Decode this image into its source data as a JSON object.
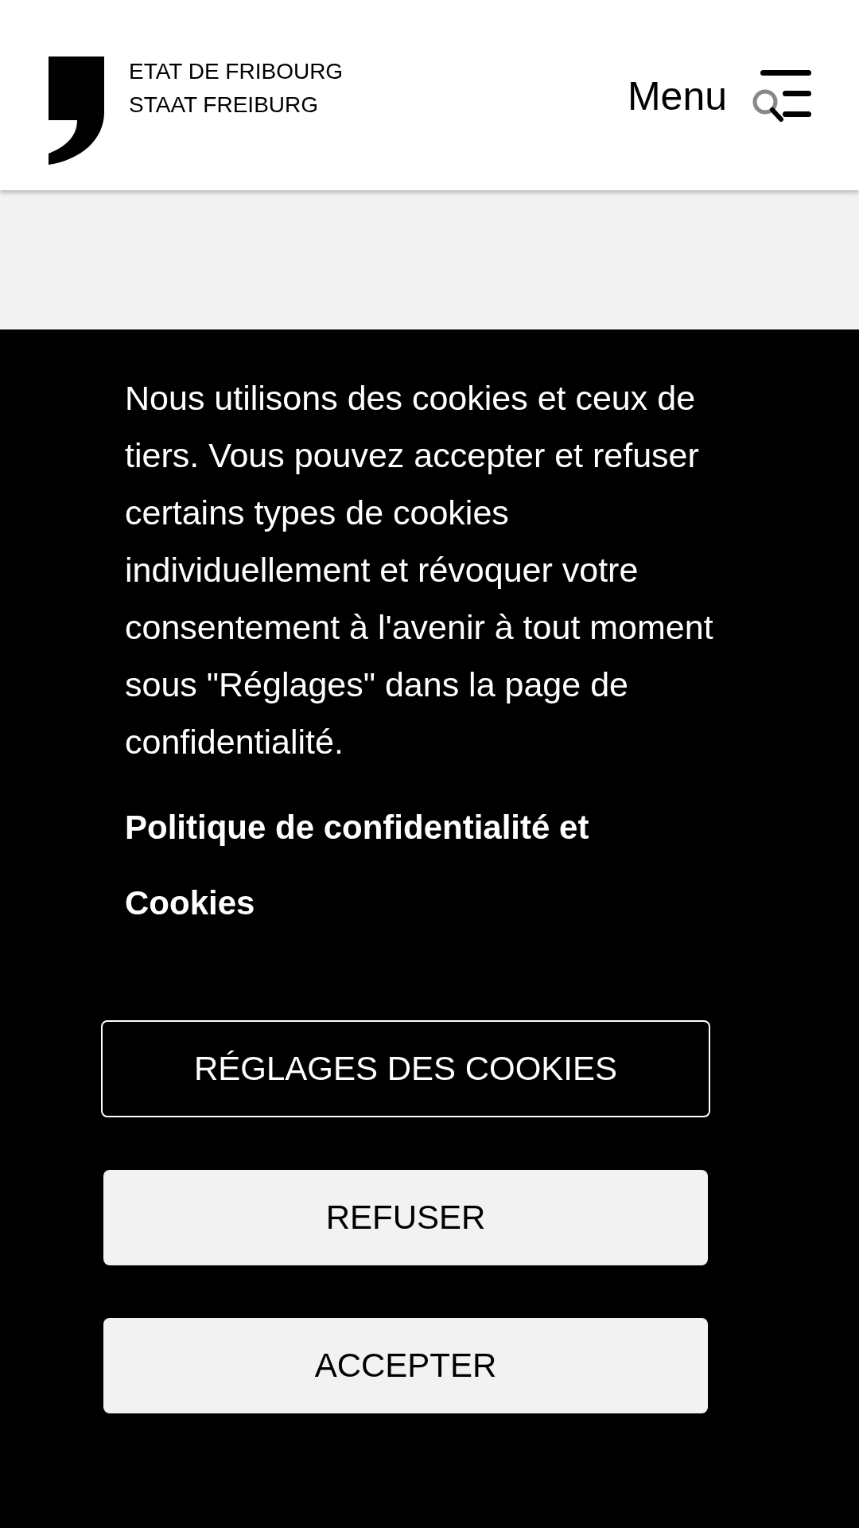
{
  "header": {
    "logo_lines": [
      "ETAT DE FRIBOURG",
      "STAAT FREIBURG"
    ],
    "menu_label": "Menu"
  },
  "cookie_banner": {
    "message": "Nous utilisons des cookies et ceux de tiers. Vous pouvez accepter et refuser certains types de cookies individuellement et révoquer votre consentement à l'avenir à tout moment sous \"Réglages\" dans la page de confidentialité.",
    "policy_link": "Politique de confidentialité et Cookies",
    "buttons": [
      {
        "label": "RÉGLAGES DES COOKIES",
        "kind": "outline"
      },
      {
        "label": "REFUSER",
        "kind": "filled"
      },
      {
        "label": "ACCEPTER",
        "kind": "filled"
      }
    ]
  }
}
